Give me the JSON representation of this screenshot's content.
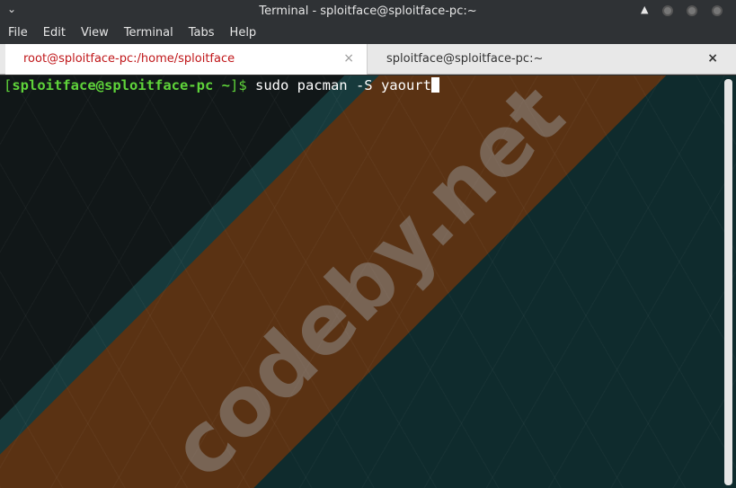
{
  "window": {
    "title": "Terminal - sploitface@sploitface-pc:~"
  },
  "menu": [
    "File",
    "Edit",
    "View",
    "Terminal",
    "Tabs",
    "Help"
  ],
  "tabs": [
    {
      "label": "root@sploitface-pc:/home/sploitface",
      "active": true
    },
    {
      "label": "sploitface@sploitface-pc:~",
      "active": false
    }
  ],
  "terminal": {
    "open_bracket": "[",
    "user_host": "sploitface@sploitface-pc",
    "dir": " ~",
    "close_prompt": "]$",
    "command": " sudo pacman -S yaourt"
  },
  "watermark": "codeby.net",
  "icons": {
    "close": "×",
    "menu": "⌄"
  }
}
